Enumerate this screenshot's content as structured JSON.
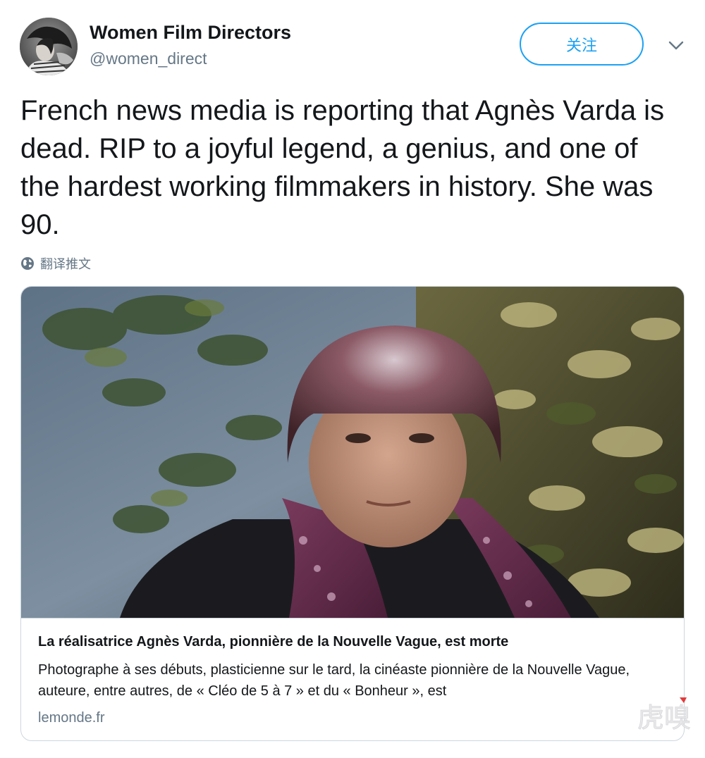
{
  "author": {
    "name": "Women Film Directors",
    "handle": "@women_direct"
  },
  "follow_label": "关注",
  "tweet_text": "French news media is reporting that Agnès Varda is dead. RIP to a joyful legend, a genius, and one of the hardest working filmmakers in history. She was 90.",
  "translate_label": "翻译推文",
  "card": {
    "title": "La réalisatrice Agnès Varda, pionnière de la Nouvelle Vague, est morte",
    "description": "Photographe à ses débuts, plasticienne sur le tard, la cinéaste pionnière de la Nouvelle Vague, auteure, entre autres, de « Cléo de 5 à 7 » et du « Bonheur », est",
    "domain": "lemonde.fr"
  },
  "icons": {
    "caret": "chevron-down-icon",
    "translate": "globe-icon"
  },
  "colors": {
    "accent": "#1da1f2",
    "text_primary": "#14171a",
    "text_secondary": "#657786",
    "border": "#ccd6dd"
  },
  "watermark_text": "虎嗅"
}
